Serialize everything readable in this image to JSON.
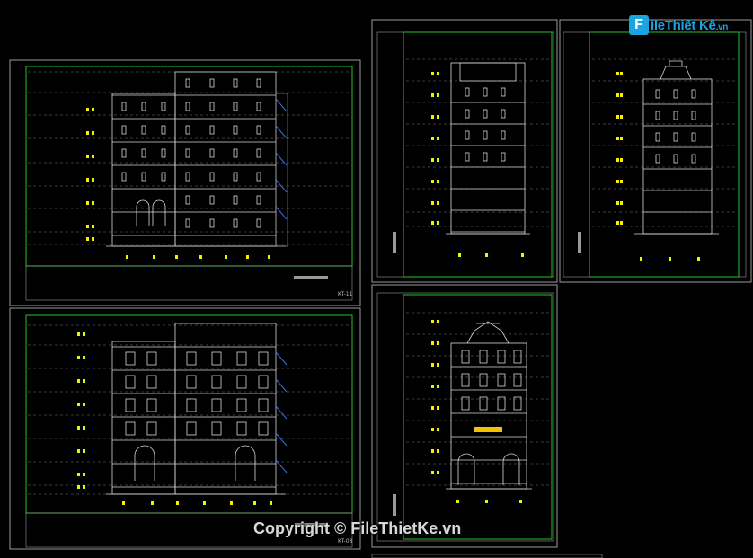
{
  "watermark": {
    "logo_letter": "F",
    "logo_text": "ileThiết",
    "logo_text2": "Kế",
    "logo_domain": ".vn",
    "copyright": "Copyright © FileThietKe.vn"
  },
  "sheets": [
    {
      "code": "KT-11"
    },
    {
      "code": "KT-08"
    }
  ],
  "colors": {
    "background": "#000000",
    "sheet_border": "#9a9a9a",
    "viewport": "#22c322",
    "building": "#d9d9d9",
    "dim_marks": "#f2f200",
    "railing": "#3a6fe0"
  }
}
